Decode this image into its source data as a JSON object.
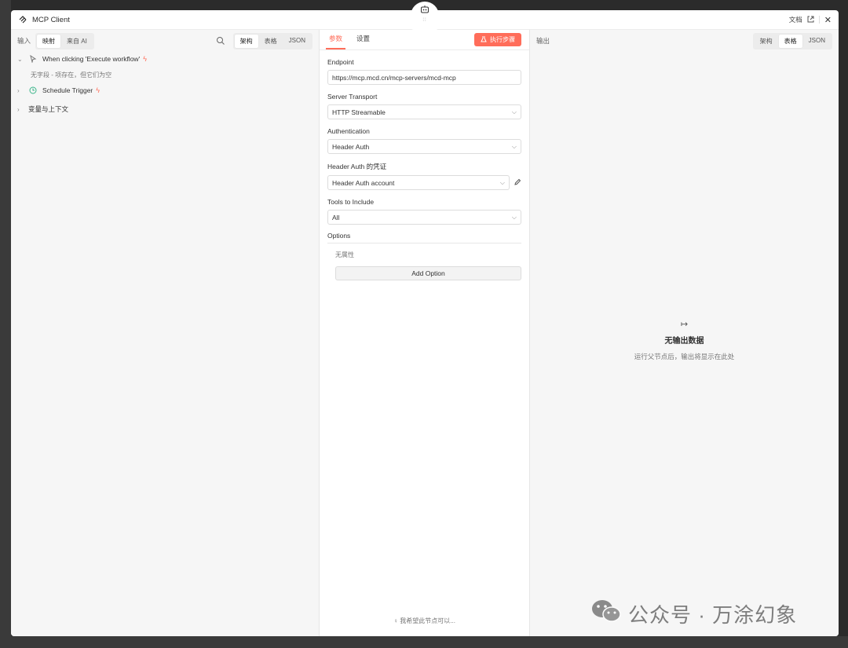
{
  "header": {
    "title": "MCP Client",
    "docs_label": "文档",
    "close_label": "✕"
  },
  "left": {
    "input_label": "输入",
    "source_tabs": [
      "映射",
      "来自 AI"
    ],
    "view_tabs": [
      "架构",
      "表格",
      "JSON"
    ],
    "tree": [
      {
        "label": "When clicking 'Execute workflow'",
        "sub": "无字段 - 项存在，但它们为空"
      },
      {
        "label": "Schedule Trigger"
      },
      {
        "label": "变量与上下文"
      }
    ]
  },
  "mid": {
    "tabs": [
      "参数",
      "设置"
    ],
    "execute_label": "执行步骤",
    "endpoint_label": "Endpoint",
    "endpoint_value": "https://mcp.mcd.cn/mcp-servers/mcd-mcp",
    "transport_label": "Server Transport",
    "transport_value": "HTTP Streamable",
    "auth_label": "Authentication",
    "auth_value": "Header Auth",
    "cred_label": "Header Auth 的凭证",
    "cred_value": "Header Auth account",
    "tools_label": "Tools to Include",
    "tools_value": "All",
    "options_label": "Options",
    "no_props": "无属性",
    "add_option": "Add Option",
    "hint": "我希望此节点可以..."
  },
  "right": {
    "output_label": "输出",
    "view_tabs": [
      "架构",
      "表格",
      "JSON"
    ],
    "empty_arrow": "↦",
    "empty_title": "无输出数据",
    "empty_sub": "运行父节点后，输出将显示在此处"
  },
  "watermark": "公众号 · 万涂幻象",
  "colors": {
    "accent": "#ff6d5a"
  }
}
